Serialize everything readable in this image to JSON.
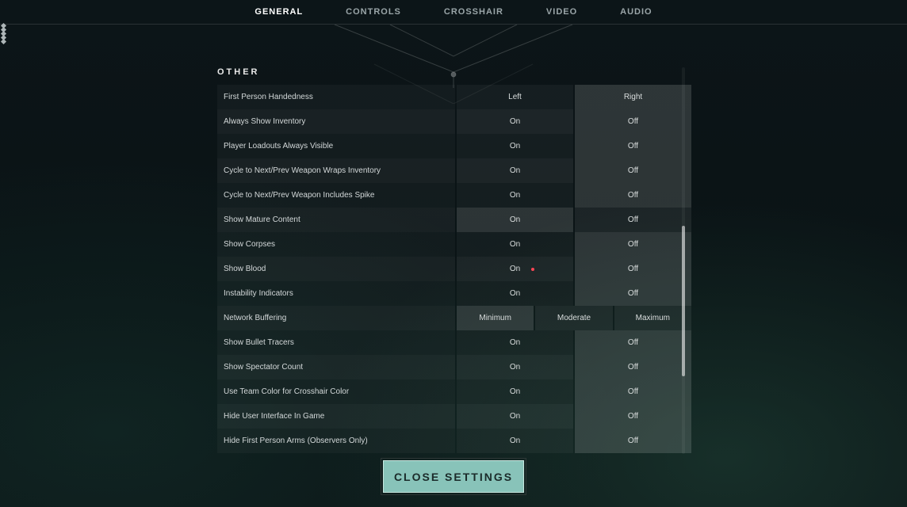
{
  "tabs": [
    "GENERAL",
    "CONTROLS",
    "CROSSHAIR",
    "VIDEO",
    "AUDIO"
  ],
  "activeTab": 0,
  "section": {
    "title": "OTHER"
  },
  "labels_onoff": {
    "on": "On",
    "off": "Off"
  },
  "labels_lr": {
    "left": "Left",
    "right": "Right"
  },
  "labels_buf": {
    "min": "Minimum",
    "mod": "Moderate",
    "max": "Maximum"
  },
  "settings": [
    {
      "label": "First Person Handedness",
      "type": "lr",
      "selected": 1
    },
    {
      "label": "Always Show Inventory",
      "type": "onoff",
      "selected": 1
    },
    {
      "label": "Player Loadouts Always Visible",
      "type": "onoff",
      "selected": 1
    },
    {
      "label": "Cycle to Next/Prev Weapon Wraps Inventory",
      "type": "onoff",
      "selected": 1
    },
    {
      "label": "Cycle to Next/Prev Weapon Includes Spike",
      "type": "onoff",
      "selected": 1
    },
    {
      "label": "Show Mature Content",
      "type": "onoff",
      "selected": 0
    },
    {
      "label": "Show Corpses",
      "type": "onoff",
      "selected": 1
    },
    {
      "label": "Show Blood",
      "type": "onoff",
      "selected": 1,
      "reddot": true
    },
    {
      "label": "Instability Indicators",
      "type": "onoff",
      "selected": 1
    },
    {
      "label": "Network Buffering",
      "type": "buf",
      "selected": 0
    },
    {
      "label": "Show Bullet Tracers",
      "type": "onoff",
      "selected": 1
    },
    {
      "label": "Show Spectator Count",
      "type": "onoff",
      "selected": 1
    },
    {
      "label": "Use Team Color for Crosshair Color",
      "type": "onoff",
      "selected": 1
    },
    {
      "label": "Hide User Interface In Game",
      "type": "onoff",
      "selected": 1
    },
    {
      "label": "Hide First Person Arms (Observers Only)",
      "type": "onoff",
      "selected": 1
    }
  ],
  "closeLabel": "CLOSE SETTINGS"
}
